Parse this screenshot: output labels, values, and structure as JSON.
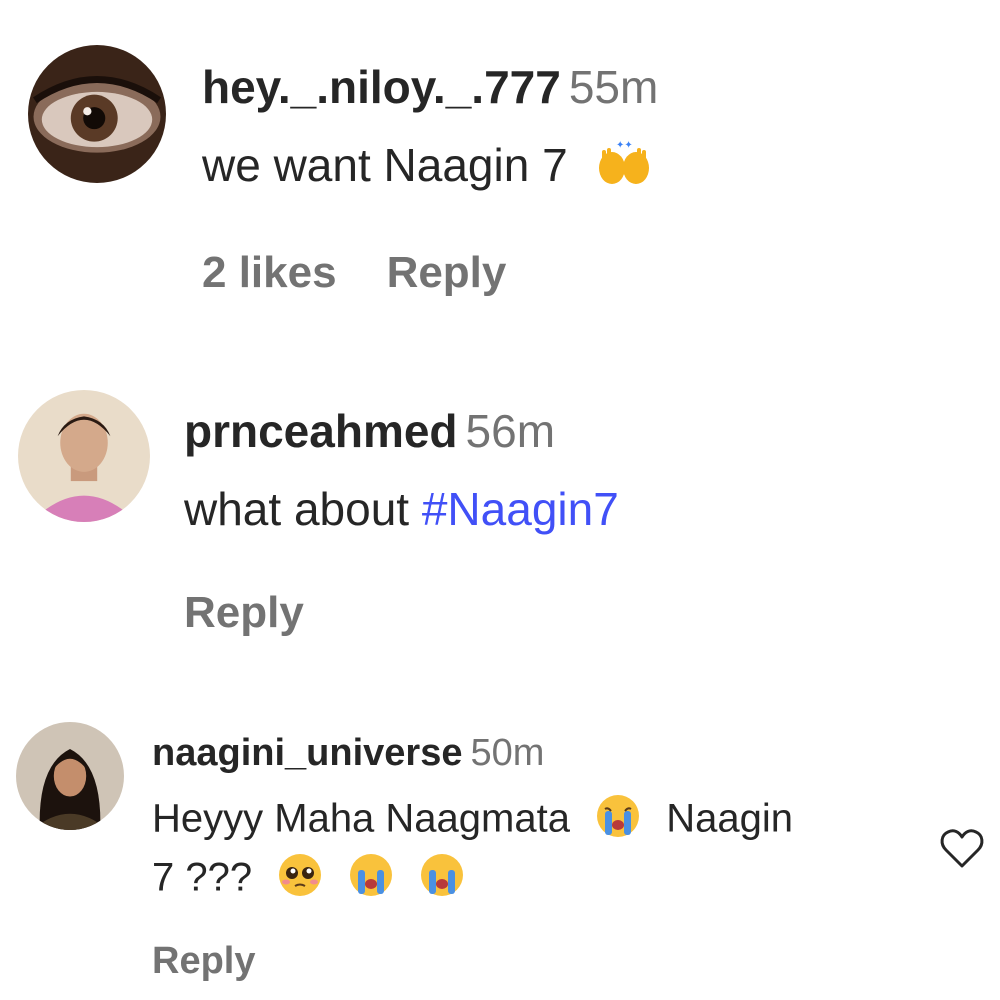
{
  "comments": [
    {
      "username": "hey._.niloy._.777",
      "time": "55m",
      "text": "we want Naagin 7",
      "emoji_icons": [
        "raising-hands-emoji-icon"
      ],
      "likes": "2 likes",
      "reply_label": "Reply"
    },
    {
      "username": "prnceahmed",
      "time": "56m",
      "text": "what about",
      "hashtag": "#Naagin7",
      "reply_label": "Reply"
    },
    {
      "username": "naagini_universe",
      "time": "50m",
      "text_line1": "Heyyy Maha Naagmata",
      "text_line1_after": "Naagin",
      "text_line2": "7 ???",
      "emoji_icons": [
        "crying-face-emoji-icon",
        "pleading-face-emoji-icon",
        "crying-face-emoji-icon",
        "crying-face-emoji-icon"
      ],
      "reply_label": "Reply"
    }
  ],
  "icons": {
    "like": "heart-icon"
  },
  "colors": {
    "username": "#262626",
    "secondary": "#737373",
    "hashtag": "#4150f7"
  }
}
